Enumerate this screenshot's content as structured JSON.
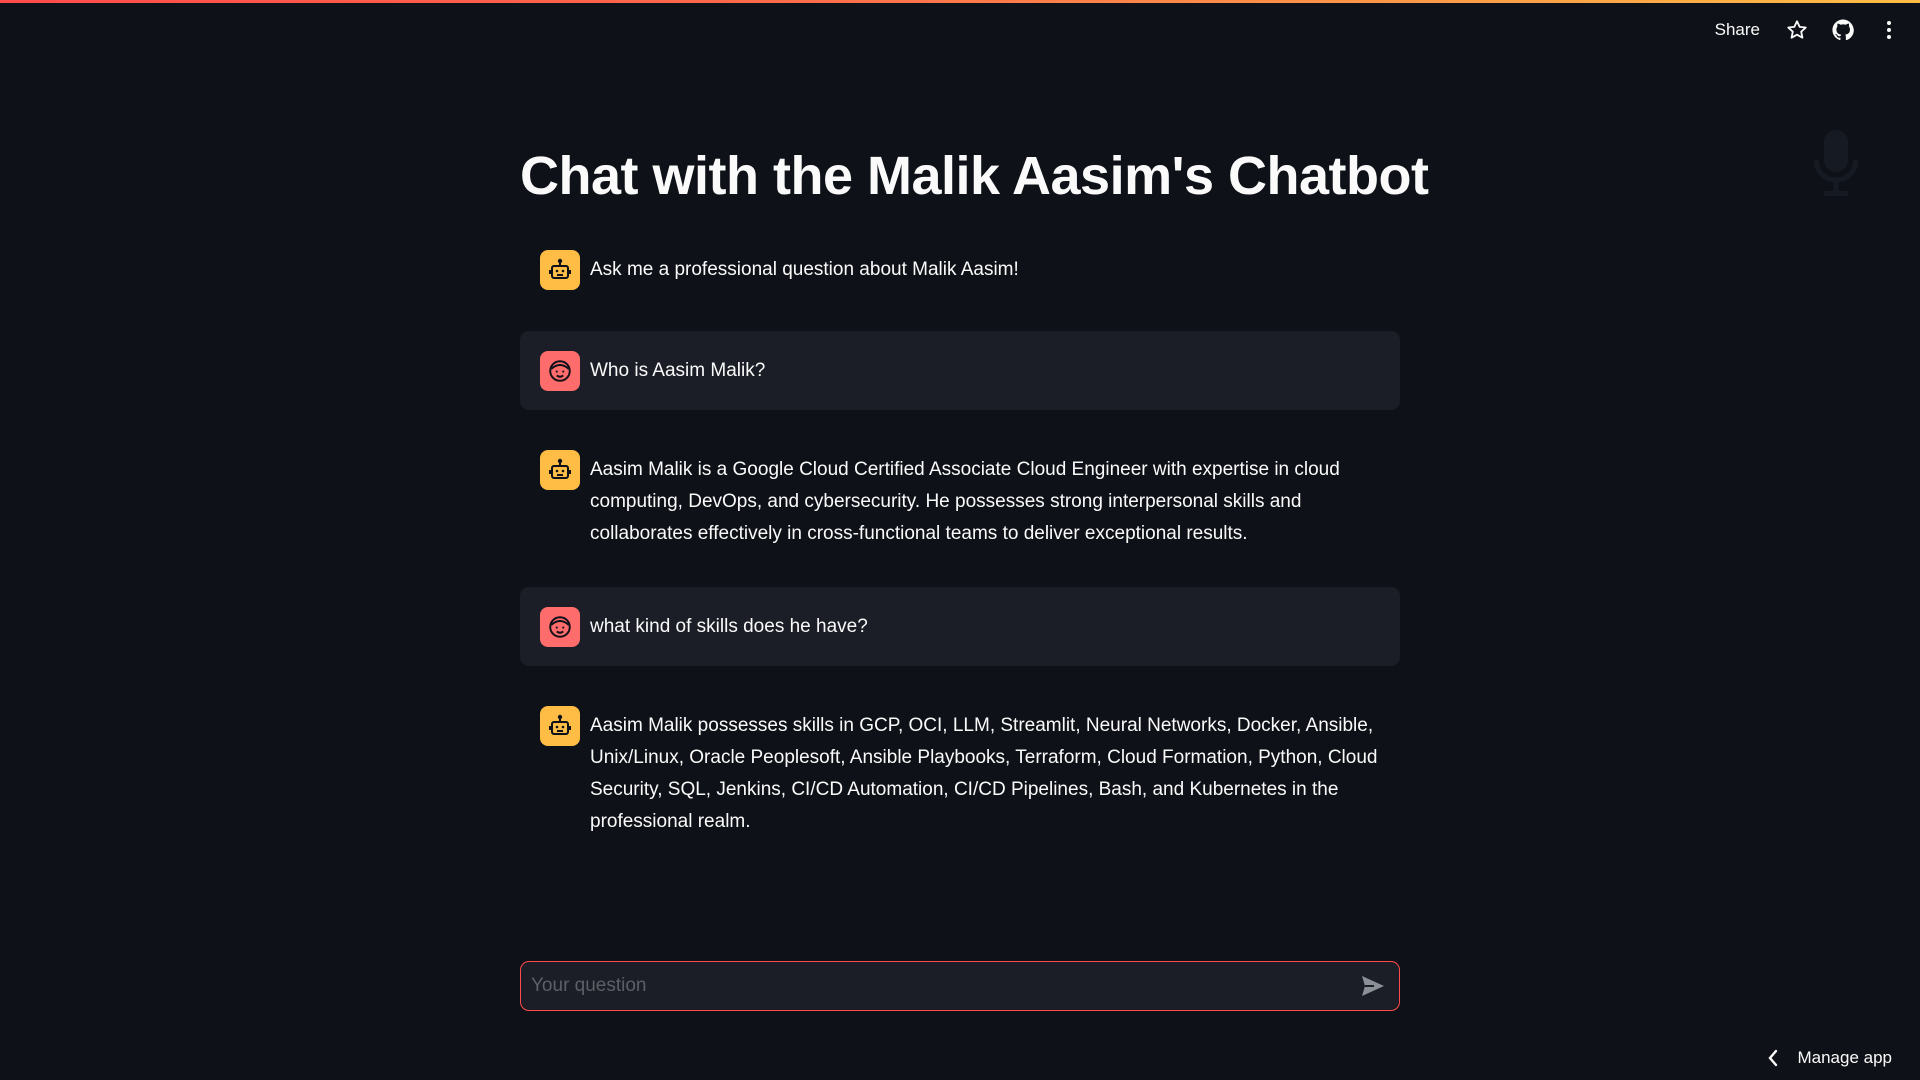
{
  "toolbar": {
    "share_label": "Share",
    "icons": [
      "star-icon",
      "github-icon",
      "more-vertical-icon"
    ]
  },
  "page": {
    "title": "Chat with the Malik Aasim's Chatbot"
  },
  "messages": [
    {
      "role": "assistant",
      "avatar": "robot-icon",
      "text": "Ask me a professional question about Malik Aasim!"
    },
    {
      "role": "user",
      "avatar": "face-icon",
      "text": "Who is Aasim Malik?"
    },
    {
      "role": "assistant",
      "avatar": "robot-icon",
      "text": "Aasim Malik is a Google Cloud Certified Associate Cloud Engineer with expertise in cloud computing, DevOps, and cybersecurity. He possesses strong interpersonal skills and collaborates effectively in cross-functional teams to deliver exceptional results."
    },
    {
      "role": "user",
      "avatar": "face-icon",
      "text": "what kind of skills does he have?"
    },
    {
      "role": "assistant",
      "avatar": "robot-icon",
      "text": "Aasim Malik possesses skills in GCP, OCI, LLM, Streamlit, Neural Networks, Docker, Ansible, Unix/Linux, Oracle Peoplesoft, Ansible Playbooks, Terraform, Cloud Formation, Python, Cloud Security, SQL, Jenkins, CI/CD Automation, CI/CD Pipelines, Bash, and Kubernetes in the professional realm."
    }
  ],
  "chat_input": {
    "placeholder": "Your question",
    "value": ""
  },
  "footer": {
    "manage_label": "Manage app"
  },
  "colors": {
    "background": "#0e1117",
    "user_bubble": "#1b1e26",
    "bot_avatar": "#ffbd45",
    "user_avatar": "#ff6c6c",
    "accent": "#ff4b4b"
  }
}
